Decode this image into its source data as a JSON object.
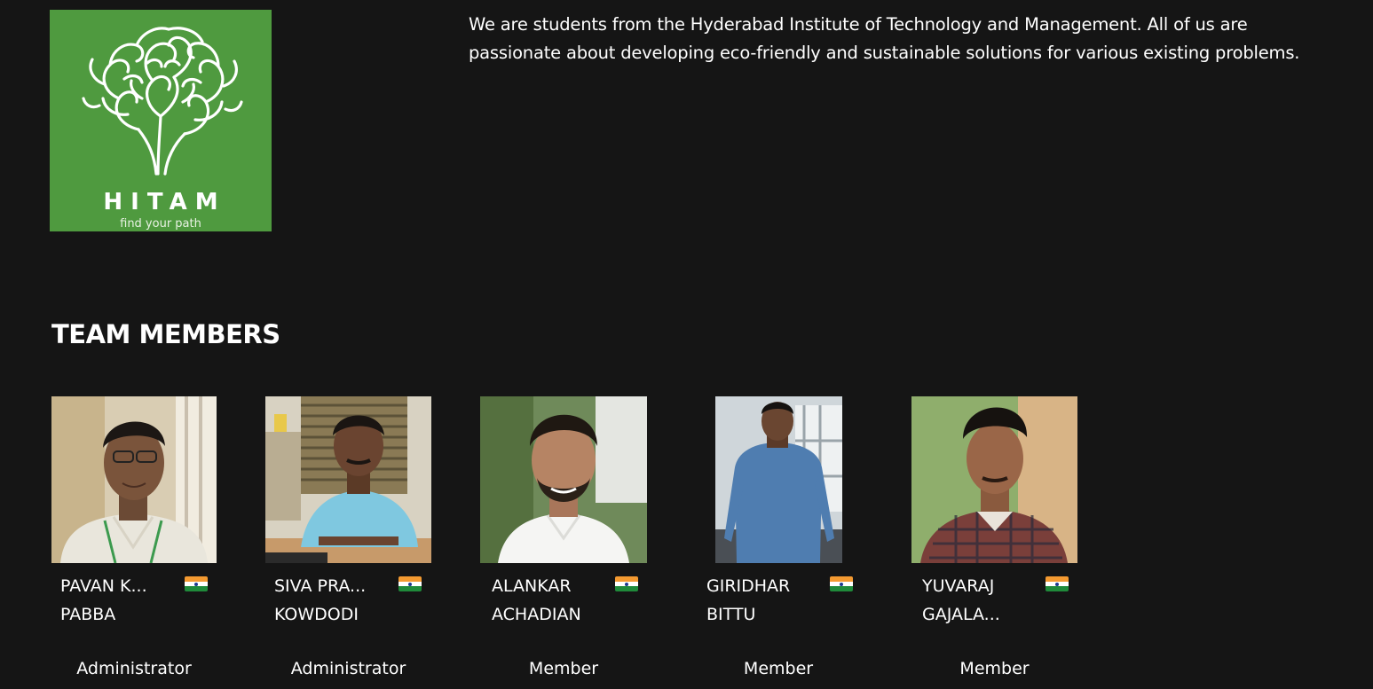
{
  "logo": {
    "name": "HITAM",
    "tagline": "find your path",
    "bg_color": "#4f9a3f"
  },
  "about": {
    "text": "We are students from the Hyderabad Institute of Technology and Management. All of us are passionate about developing eco-friendly and sustainable solutions for various existing problems."
  },
  "team": {
    "title": "TEAM MEMBERS",
    "members": [
      {
        "name_line1": "PAVAN K...",
        "name_line2": "PABBA",
        "role": "Administrator",
        "flag": "india-flag-icon"
      },
      {
        "name_line1": "SIVA PRA...",
        "name_line2": "KOWDODI",
        "role": "Administrator",
        "flag": "india-flag-icon"
      },
      {
        "name_line1": "ALANKAR",
        "name_line2": "ACHADIAN",
        "role": "Member",
        "flag": "india-flag-icon"
      },
      {
        "name_line1": "GIRIDHAR",
        "name_line2": "BITTU",
        "role": "Member",
        "flag": "india-flag-icon"
      },
      {
        "name_line1": "YUVARAJ",
        "name_line2": "GAJALA...",
        "role": "Member",
        "flag": "india-flag-icon"
      }
    ]
  }
}
